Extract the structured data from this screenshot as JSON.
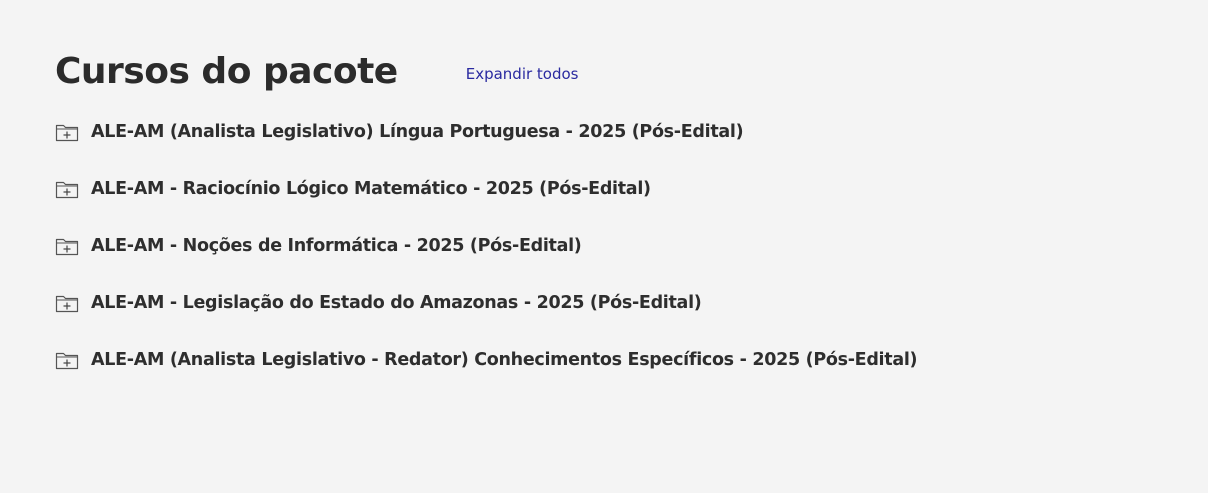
{
  "section": {
    "title": "Cursos do pacote",
    "expand_all_label": "Expandir todos"
  },
  "courses": [
    {
      "label": "ALE-AM (Analista Legislativo) Língua Portuguesa - 2025 (Pós-Edital)",
      "icon": "folder-plus-icon"
    },
    {
      "label": "ALE-AM - Raciocínio Lógico Matemático - 2025 (Pós-Edital)",
      "icon": "folder-plus-icon"
    },
    {
      "label": "ALE-AM - Noções de Informática - 2025 (Pós-Edital)",
      "icon": "folder-plus-icon"
    },
    {
      "label": "ALE-AM - Legislação do Estado do Amazonas - 2025 (Pós-Edital)",
      "icon": "folder-plus-icon"
    },
    {
      "label": "ALE-AM (Analista Legislativo - Redator) Conhecimentos Específicos - 2025 (Pós-Edital)",
      "icon": "folder-plus-icon"
    }
  ],
  "colors": {
    "background": "#f4f4f4",
    "text": "#2e2e2e",
    "link": "#2a2aa0"
  }
}
